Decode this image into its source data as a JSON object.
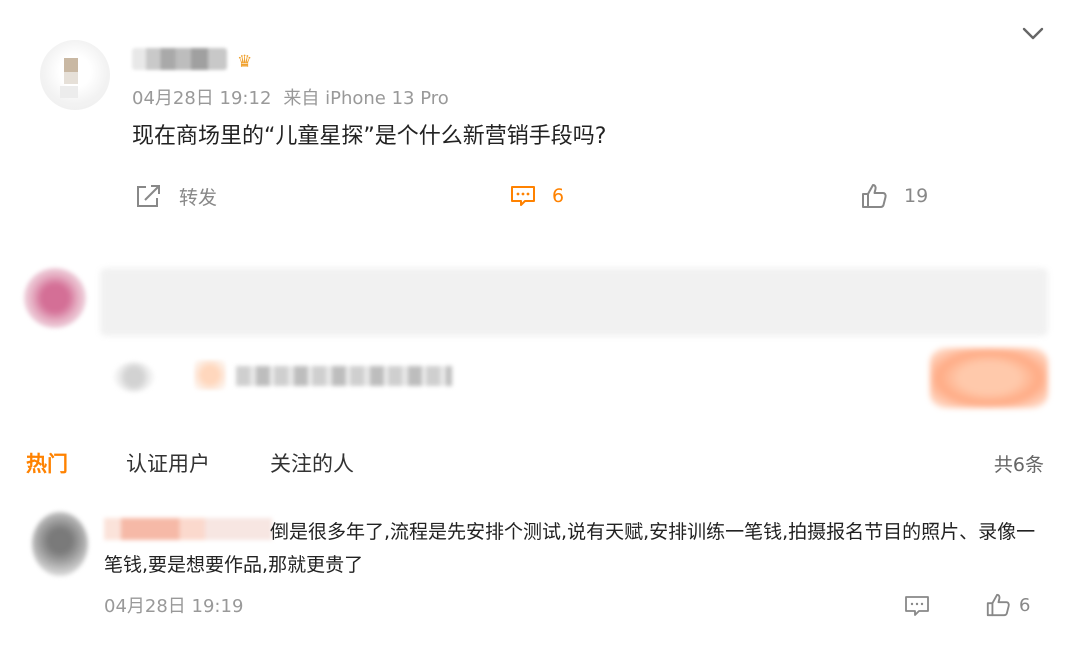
{
  "post": {
    "meta_time": "04月28日 19:12",
    "meta_source": "来自 iPhone 13 Pro",
    "text": "现在商场里的“儿童星探”是个什么新营销手段吗?",
    "actions": {
      "repost_label": "转发",
      "comment_count": "6",
      "like_count": "19"
    },
    "icons": {
      "repost": "share-icon",
      "comment": "comment-icon",
      "like": "thumbs-up-icon",
      "expand": "chevron-down-icon",
      "badge": "user-badge-icon"
    }
  },
  "comments_section": {
    "tabs": [
      "热门",
      "认证用户",
      "关注的人"
    ],
    "active_tab": "热门",
    "total_count": "共6条"
  },
  "comments": [
    {
      "text": "倒是很多年了,流程是先安排个测试,说有天赋,安排训练一笔钱,拍摄报名节目的照片、录像一笔钱,要是想要作品,那就更贵了",
      "time": "04月28日 19:19",
      "like_count": "6"
    }
  ],
  "colors": {
    "accent": "#ff8200",
    "muted_text": "#999999",
    "body_text": "#222222"
  }
}
